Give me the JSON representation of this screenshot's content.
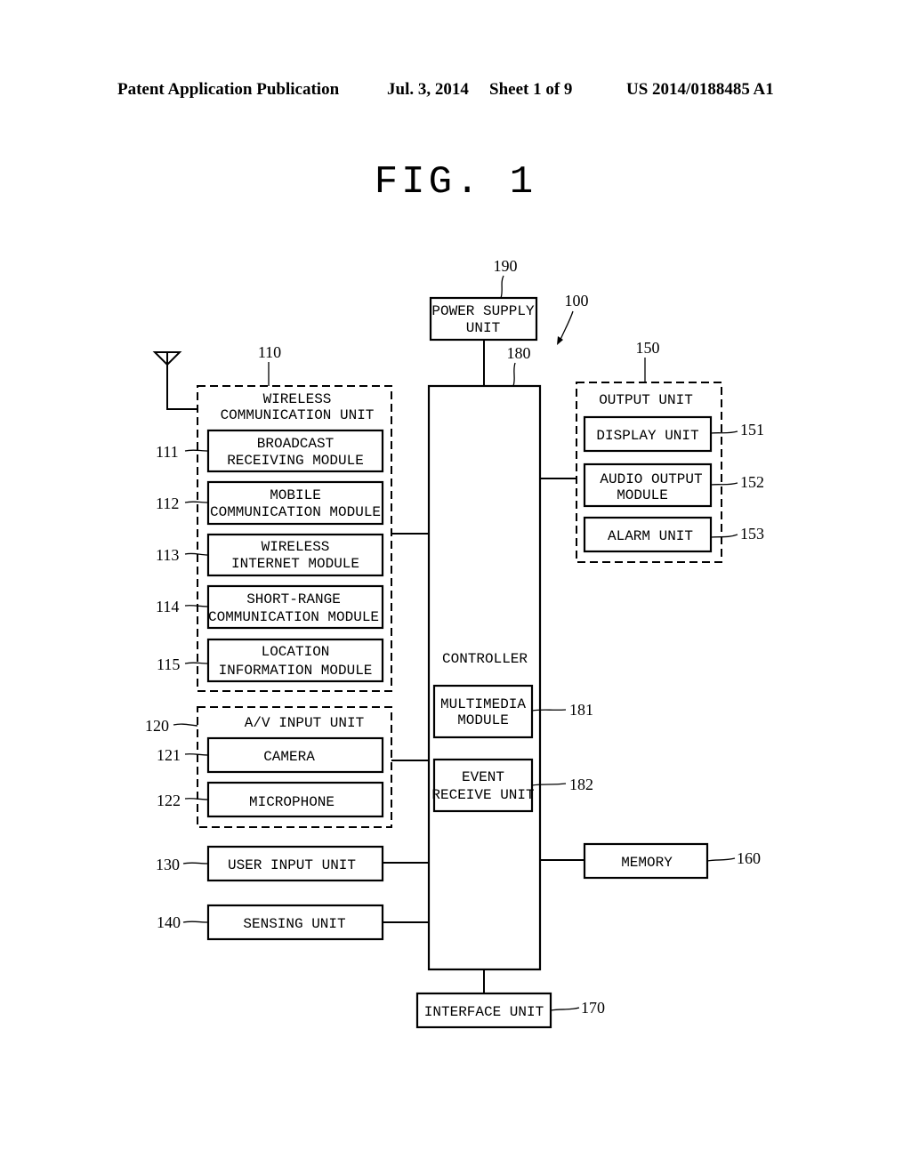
{
  "header": {
    "publication_type": "Patent Application Publication",
    "date": "Jul. 3, 2014",
    "sheet": "Sheet 1 of 9",
    "publication_number": "US 2014/0188485 A1"
  },
  "figure": {
    "title": "FIG. 1",
    "system_ref": "100",
    "blocks": {
      "power_supply": {
        "ref": "190",
        "lines": [
          "POWER SUPPLY",
          "UNIT"
        ]
      },
      "controller": {
        "ref": "180",
        "label": "CONTROLLER"
      },
      "multimedia": {
        "ref": "181",
        "lines": [
          "MULTIMEDIA",
          "MODULE"
        ]
      },
      "event_receive": {
        "ref": "182",
        "lines": [
          "EVENT",
          "RECEIVE UNIT"
        ]
      },
      "wireless_comm": {
        "ref": "110",
        "lines": [
          "WIRELESS",
          "COMMUNICATION UNIT"
        ]
      },
      "broadcast": {
        "ref": "111",
        "lines": [
          "BROADCAST",
          "RECEIVING MODULE"
        ]
      },
      "mobile_comm": {
        "ref": "112",
        "lines": [
          "MOBILE",
          "COMMUNICATION MODULE"
        ]
      },
      "wireless_internet": {
        "ref": "113",
        "lines": [
          "WIRELESS",
          "INTERNET MODULE"
        ]
      },
      "short_range": {
        "ref": "114",
        "lines": [
          "SHORT-RANGE",
          "COMMUNICATION MODULE"
        ]
      },
      "location": {
        "ref": "115",
        "lines": [
          "LOCATION",
          "INFORMATION MODULE"
        ]
      },
      "av_input": {
        "ref": "120",
        "label": "A/V INPUT UNIT"
      },
      "camera": {
        "ref": "121",
        "label": "CAMERA"
      },
      "microphone": {
        "ref": "122",
        "label": "MICROPHONE"
      },
      "user_input": {
        "ref": "130",
        "label": "USER INPUT UNIT"
      },
      "sensing": {
        "ref": "140",
        "label": "SENSING UNIT"
      },
      "output": {
        "ref": "150",
        "label": "OUTPUT UNIT"
      },
      "display": {
        "ref": "151",
        "label": "DISPLAY UNIT"
      },
      "audio_output": {
        "ref": "152",
        "lines": [
          "AUDIO OUTPUT",
          "MODULE"
        ]
      },
      "alarm": {
        "ref": "153",
        "label": "ALARM UNIT"
      },
      "memory": {
        "ref": "160",
        "label": "MEMORY"
      },
      "interface": {
        "ref": "170",
        "label": "INTERFACE UNIT"
      }
    }
  }
}
